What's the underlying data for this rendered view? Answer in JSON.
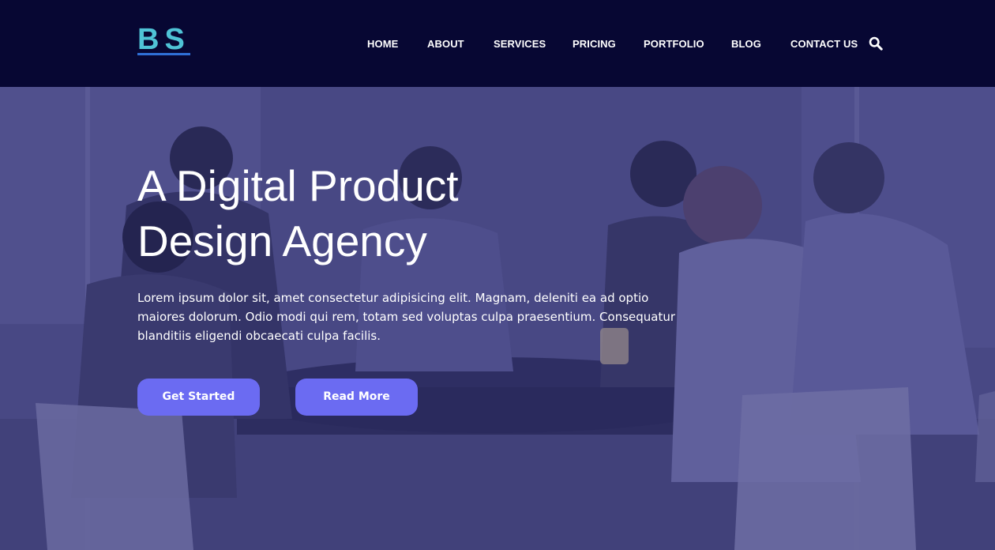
{
  "brand": {
    "logo_text": "BS"
  },
  "nav": {
    "items": [
      {
        "label": "HOME"
      },
      {
        "label": "ABOUT"
      },
      {
        "label": "SERVICES"
      },
      {
        "label": "PRICING"
      },
      {
        "label": "PORTFOLIO"
      },
      {
        "label": "BLOG"
      },
      {
        "label": "CONTACT US"
      }
    ],
    "search_icon": "search-icon"
  },
  "hero": {
    "title_line1": "A Digital Product",
    "title_line2": "Design Agency",
    "description": "Lorem ipsum dolor sit, amet consectetur adipisicing elit. Magnam, deleniti ea ad optio maiores dolorum. Odio modi qui rem, totam sed voluptas culpa praesentium. Consequatur blanditiis eligendi obcaecati culpa facilis.",
    "primary_button": "Get Started",
    "secondary_button": "Read More"
  },
  "colors": {
    "header_bg": "#070733",
    "logo": "#4fc3d6",
    "accent_button": "#6b6bf2",
    "text": "#ffffff"
  }
}
